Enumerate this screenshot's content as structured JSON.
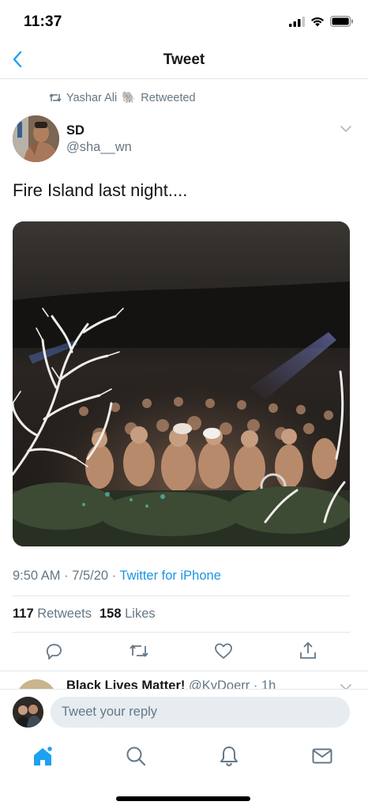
{
  "status_bar": {
    "time": "11:37",
    "icons": [
      "cellular-signal-icon",
      "wifi-icon",
      "battery-icon"
    ]
  },
  "header": {
    "title": "Tweet",
    "back_icon": "chevron-left-icon"
  },
  "tweet": {
    "retweet_context": {
      "icon": "retweet-icon",
      "user": "Yashar Ali",
      "emoji": "🐘",
      "label": "Retweeted"
    },
    "author": {
      "name": "SD",
      "handle": "@sha__wn"
    },
    "text": "Fire Island last night....",
    "photo_alt": "Crowd at night",
    "time": "9:50 AM",
    "date": "7/5/20",
    "separator": "·",
    "source": "Twitter for iPhone",
    "stats": {
      "retweets_count": "117",
      "retweets_label": "Retweets",
      "likes_count": "158",
      "likes_label": "Likes"
    },
    "actions": [
      "reply-icon",
      "retweet-icon",
      "like-icon",
      "share-icon"
    ]
  },
  "reply_peek": {
    "name": "Black Lives Matter!",
    "handle": "@KyDoerr · 1h"
  },
  "reply_bar": {
    "placeholder": "Tweet your reply"
  },
  "tabs": [
    "home-icon",
    "search-icon",
    "notifications-icon",
    "messages-icon"
  ],
  "colors": {
    "accent": "#1da1f2",
    "link": "#1b95e0",
    "secondary_text": "#657786",
    "primary_text": "#14171a",
    "divider": "#e1e8ed",
    "input_bg": "#e6ecf0"
  }
}
